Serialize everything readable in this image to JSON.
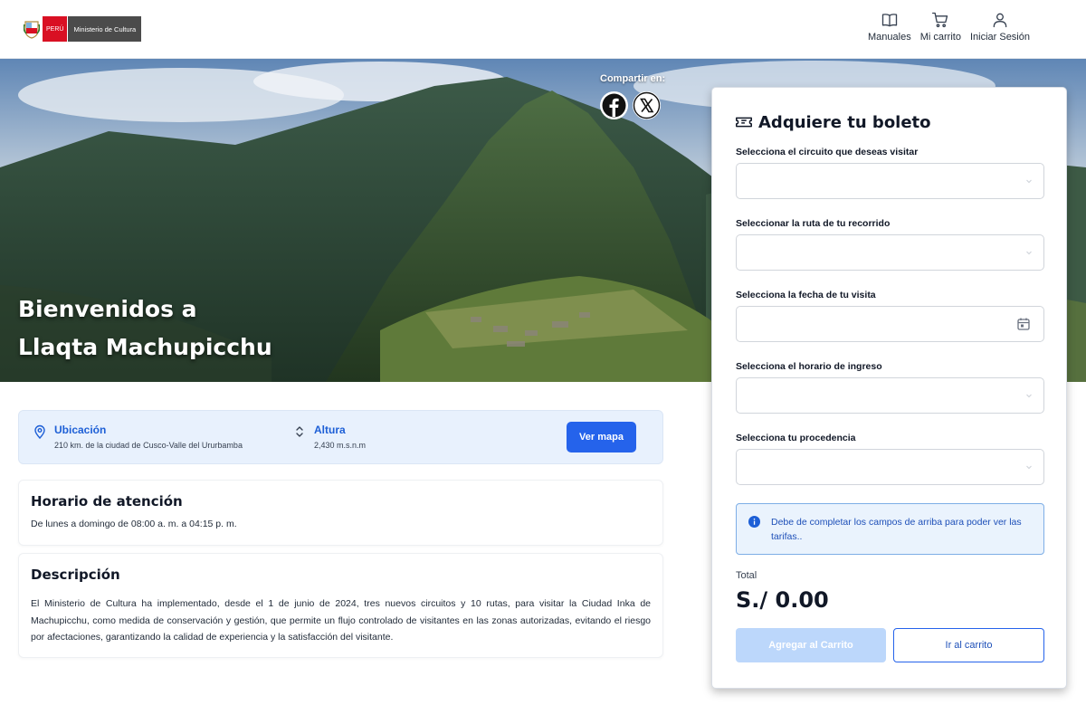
{
  "header": {
    "logo": {
      "country": "PERÚ",
      "ministry": "Ministerio de Cultura"
    },
    "nav": [
      {
        "label": "Manuales",
        "icon": "book-icon"
      },
      {
        "label": "Mi carrito",
        "icon": "cart-icon"
      },
      {
        "label": "Iniciar Sesión",
        "icon": "user-icon"
      }
    ]
  },
  "hero": {
    "title_line1": "Bienvenidos a",
    "title_line2": "Llaqta Machupicchu",
    "share_label": "Compartir en:"
  },
  "info": {
    "location_title": "Ubicación",
    "location_text": "210 km. de la ciudad de Cusco-Valle del Ururbamba",
    "altitude_title": "Altura",
    "altitude_text": "2,430 m.s.n.m",
    "map_button": "Ver mapa"
  },
  "hours": {
    "title": "Horario de atención",
    "text": "De lunes a domingo de 08:00 a. m. a 04:15 p. m."
  },
  "description": {
    "title": "Descripción",
    "text": "El Ministerio de Cultura ha implementado, desde el 1 de junio de 2024, tres nuevos circuitos y 10 rutas, para visitar la Ciudad Inka de Machupicchu, como medida de conservación y gestión, que permite un flujo controlado de visitantes en las zonas autorizadas, evitando el riesgo por afectaciones, garantizando la calidad de experiencia y la satisfacción del visitante."
  },
  "booking": {
    "title": "Adquiere tu boleto",
    "fields": {
      "circuit_label": "Selecciona el circuito que deseas visitar",
      "circuit_value": "",
      "route_label": "Seleccionar la ruta de tu recorrido",
      "route_value": "",
      "date_label": "Selecciona la fecha de tu visita",
      "date_value": "",
      "schedule_label": "Selecciona el horario de ingreso",
      "schedule_value": "",
      "origin_label": "Selecciona tu procedencia",
      "origin_value": ""
    },
    "notice": "Debe de completar los campos de arriba para poder ver las tarifas..",
    "total_label": "Total",
    "total_value": "S./ 0.00",
    "add_button": "Agregar al Carrito",
    "cart_button": "Ir al carrito"
  },
  "colors": {
    "primary": "#2563eb",
    "primary_disabled": "#bcd7fb",
    "info_bg": "#e8f1fd",
    "peru_red": "#d91023"
  }
}
